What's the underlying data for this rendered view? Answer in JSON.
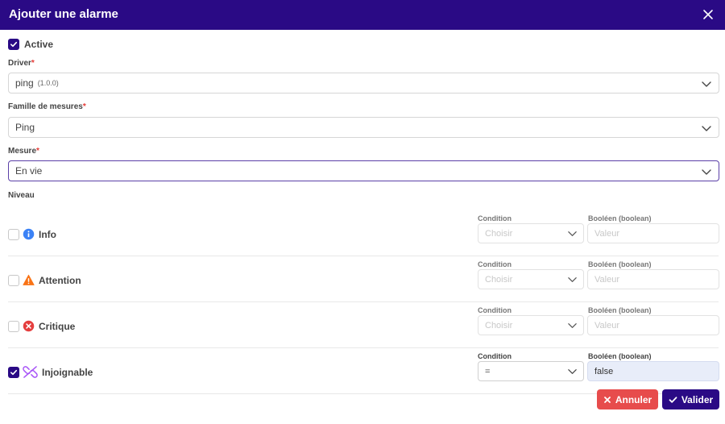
{
  "dialog": {
    "title": "Ajouter une alarme"
  },
  "active": {
    "label": "Active",
    "checked": true
  },
  "driver": {
    "label": "Driver",
    "required_mark": "*",
    "value": "ping",
    "version": "(1.0.0)"
  },
  "famille": {
    "label": "Famille de mesures",
    "required_mark": "*",
    "value": "Ping"
  },
  "mesure": {
    "label": "Mesure",
    "required_mark": "*",
    "value": "En vie"
  },
  "niveau": {
    "label": "Niveau"
  },
  "levels": [
    {
      "name": "Info",
      "icon": "info-icon",
      "checked": false,
      "condition_label": "Condition",
      "condition_value": "Choisir",
      "bool_label": "Booléen (boolean)",
      "bool_value": "Valeur",
      "enabled": false
    },
    {
      "name": "Attention",
      "icon": "warning-icon",
      "checked": false,
      "condition_label": "Condition",
      "condition_value": "Choisir",
      "bool_label": "Booléen (boolean)",
      "bool_value": "Valeur",
      "enabled": false
    },
    {
      "name": "Critique",
      "icon": "critical-icon",
      "checked": false,
      "condition_label": "Condition",
      "condition_value": "Choisir",
      "bool_label": "Booléen (boolean)",
      "bool_value": "Valeur",
      "enabled": false
    },
    {
      "name": "Injoignable",
      "icon": "broken-link-icon",
      "checked": true,
      "condition_label": "Condition",
      "condition_value": "=",
      "bool_label": "Booléen (boolean)",
      "bool_value": "false",
      "enabled": true
    }
  ],
  "actions": {
    "cancel_label": "Annuler",
    "ok_label": "Valider"
  },
  "colors": {
    "primary": "#2a0a85",
    "danger": "#e74c4c",
    "info": "#3b82f6",
    "warning": "#f97316",
    "critical": "#e53e3e",
    "unreachable": "#a855f7"
  }
}
